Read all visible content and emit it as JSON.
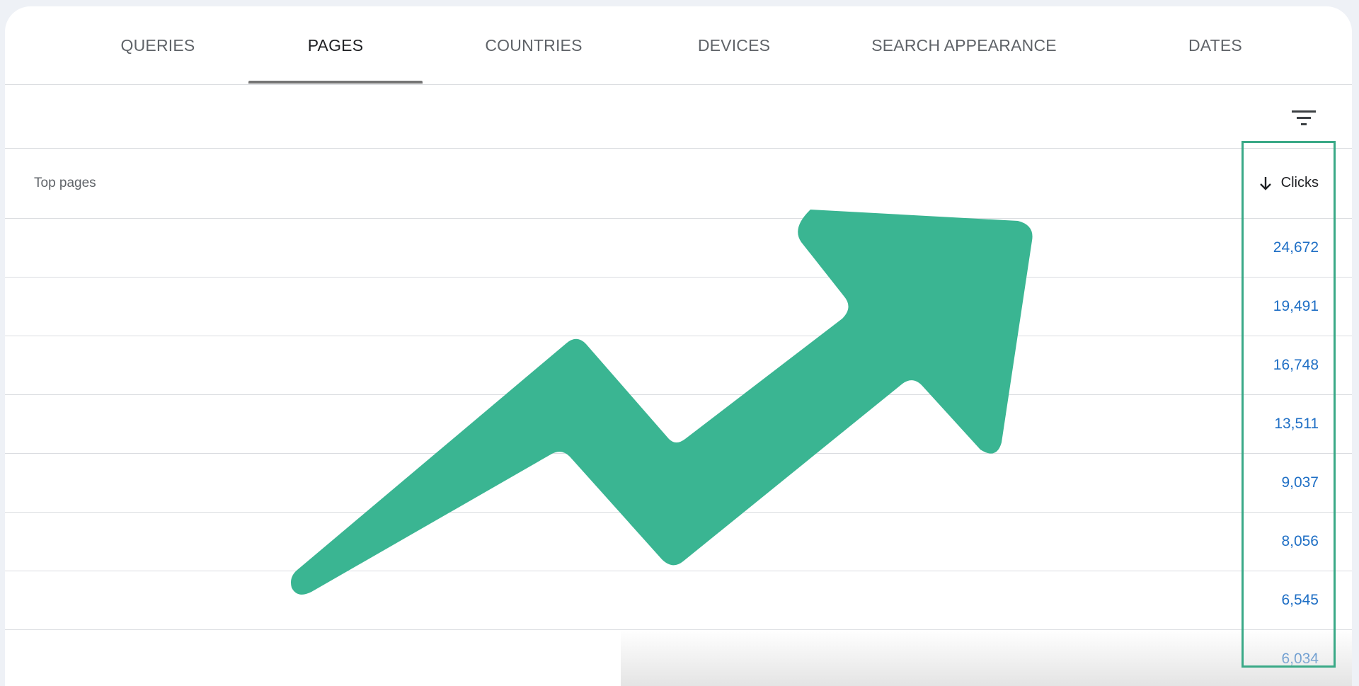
{
  "tabs": [
    {
      "label": "QUERIES"
    },
    {
      "label": "PAGES"
    },
    {
      "label": "COUNTRIES"
    },
    {
      "label": "DEVICES"
    },
    {
      "label": "SEARCH APPEARANCE"
    },
    {
      "label": "DATES"
    }
  ],
  "active_tab": "PAGES",
  "table": {
    "title": "Top pages",
    "clicks_header": "Clicks",
    "sort_icon": "arrow-down-icon",
    "clicks": [
      "24,672",
      "19,491",
      "16,748",
      "13,511",
      "9,037",
      "8,056",
      "6,545",
      "6,034"
    ]
  },
  "icons": {
    "filter": "filter-icon",
    "trend": "trending-up-arrow"
  },
  "colors": {
    "accent_green": "#3aa987",
    "link_blue": "#1f6fc5",
    "tab_underline": "#757575"
  }
}
